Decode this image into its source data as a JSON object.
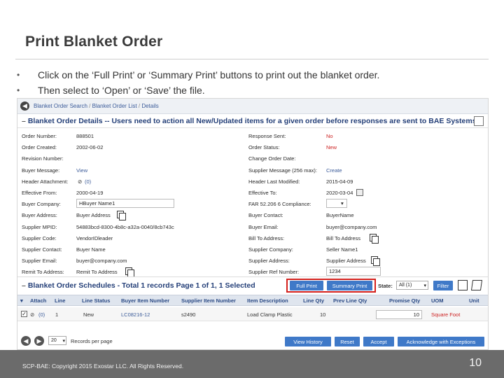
{
  "slide": {
    "title": "Print Blanket Order",
    "bullets": [
      "Click on the ‘Full Print’ or ‘Summary Print’ buttons to print out the blanket order.",
      "Then select to ‘Open’ or ‘Save’ the file."
    ]
  },
  "breadcrumb": {
    "part1": "Blanket Order Search",
    "part2": "Blanket Order List",
    "part3": "Details",
    "sep": " / "
  },
  "details": {
    "title": "Blanket Order Details -- Users need to action all New/Updated items for a given order before responses are sent to BAE Systems.",
    "left": [
      {
        "label": "Order Number:",
        "value": "888501"
      },
      {
        "label": "Order Created:",
        "value": "2002-06-02"
      },
      {
        "label": "Revision Number:",
        "value": ""
      },
      {
        "label": "Buyer Message:",
        "value": "View"
      },
      {
        "label": "Header Attachment:",
        "value": "(0)"
      },
      {
        "label": "Effective From:",
        "value": "2000-04-19"
      },
      {
        "label": "Buyer Company:",
        "value": "HBuyer Name1"
      },
      {
        "label": "Buyer Address:",
        "value": "Buyer Address"
      },
      {
        "label": "Supplier MPID:",
        "value": "54883bcd-8300-4b8c-a32a-0040/8cb743c"
      },
      {
        "label": "Supplier Code:",
        "value": "VendorIDleader"
      },
      {
        "label": "Supplier Contact:",
        "value": "Buyer Name"
      },
      {
        "label": "Supplier Email:",
        "value": "buyer@company.com"
      },
      {
        "label": "Remit To Address:",
        "value": "Remit To Address"
      }
    ],
    "right": [
      {
        "label": "Response Sent:",
        "value": "No"
      },
      {
        "label": "Order Status:",
        "value": "New"
      },
      {
        "label": "Change Order Date:",
        "value": ""
      },
      {
        "label": "Supplier Message (256 max):",
        "value": "Create"
      },
      {
        "label": "Header Last Modified:",
        "value": "2015-04-09"
      },
      {
        "label": "Effective To:",
        "value": "2020-03-04"
      },
      {
        "label": "FAR 52.206 6 Compliance:",
        "value": ""
      },
      {
        "label": "Buyer Contact:",
        "value": "BuyerName"
      },
      {
        "label": "Buyer Email:",
        "value": "buyer@company.com"
      },
      {
        "label": "Bill To Address:",
        "value": "Bill To Address"
      },
      {
        "label": "Supplier Company:",
        "value": "Seller Name1"
      },
      {
        "label": "Supplier Address:",
        "value": "Supplier Address"
      },
      {
        "label": "Supplier Ref Number:",
        "value": "1234"
      }
    ]
  },
  "schedules": {
    "title": "Blanket Order Schedules - Total 1 records Page 1 of 1, 1 Selected",
    "full_print": "Full Print",
    "summary_print": "Summary Print",
    "state_label": "State:",
    "state_value": "All (1)",
    "filter": "Filter",
    "columns": [
      "Attach",
      "Line",
      "Line Status",
      "Buyer Item Number",
      "Supplier Item Number",
      "Item Description",
      "Line Qty",
      "Prev Line Qty",
      "Promise Qty",
      "UOM",
      "Unit"
    ],
    "row": {
      "attach": "(0)",
      "line": "1",
      "status": "New",
      "buyer_item": "LC08216-12",
      "supplier_item": "s2490",
      "description": "Load Clamp Plastic",
      "qty": "10",
      "promise": "10",
      "uom": "Square Foot"
    }
  },
  "pager": {
    "per_page": "20",
    "per_page_label": "Records per page",
    "view_history": "View History",
    "reset": "Reset",
    "accept": "Accept",
    "acknowledge": "Acknowledge with Exceptions"
  },
  "footer": {
    "copyright": "SCP-BAE: Copyright 2015 Exostar LLC. All Rights Reserved.",
    "page": "10"
  },
  "colors": {
    "accent": "#3f79c8",
    "highlight": "#d4201c",
    "footer": "#6b6b6b"
  }
}
